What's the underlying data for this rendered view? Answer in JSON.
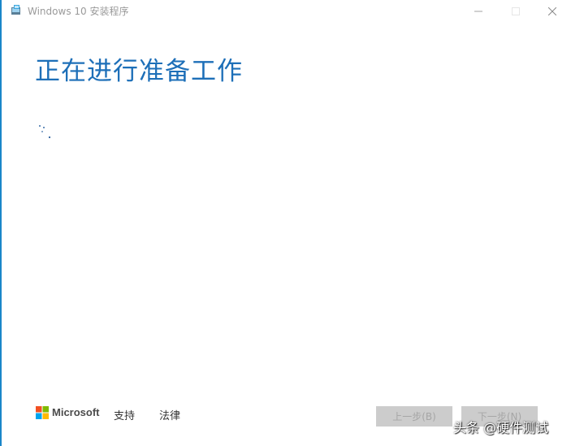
{
  "window": {
    "title": "Windows 10 安装程序",
    "accent_color": "#1d6fb8",
    "border_color": "#1a86c9",
    "icons": [
      "setup-app-icon",
      "minimize-icon",
      "maximize-icon",
      "close-icon"
    ]
  },
  "main": {
    "heading": "正在进行准备工作",
    "status_indicator": "loading-spinner"
  },
  "footer": {
    "brand": "Microsoft",
    "links": {
      "support": "支持",
      "legal": "法律"
    },
    "buttons": {
      "back": "上一步(B)",
      "next": "下一步(N)"
    }
  },
  "overlay": {
    "watermark": "头条 @硬件测试"
  }
}
